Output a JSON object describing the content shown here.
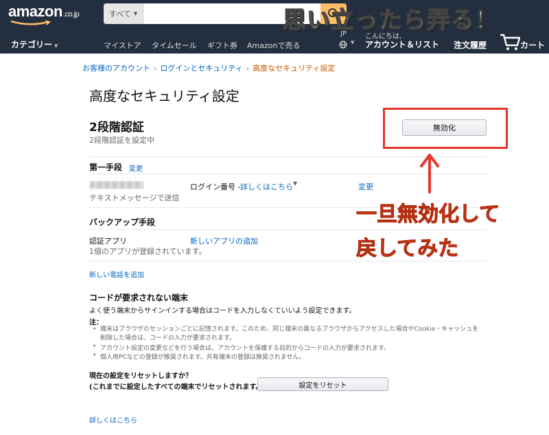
{
  "header": {
    "logo_text": "amazon",
    "logo_suffix": ".co.jp",
    "search_category": "すべて",
    "search_placeholder": "",
    "blog_title": "思い立ったら弄る！",
    "category_menu": "カテゴリー",
    "nav_links": [
      "マイストア",
      "タイムセール",
      "ギフト券",
      "Amazonで売る"
    ],
    "language": "JP",
    "greeting": "こんにちは,",
    "account_list": "アカウント＆リスト",
    "orders": "注文履歴",
    "cart": "カート",
    "colors": {
      "background": "#232f3e",
      "search_button": "#febd69"
    }
  },
  "breadcrumb": {
    "items": [
      "お客様のアカウント",
      "ログインとセキュリティ"
    ],
    "current": "高度なセキュリティ設定"
  },
  "page": {
    "title": "高度なセキュリティ設定",
    "two_step": {
      "heading": "2段階認証",
      "status": "2段階認証を設定中",
      "disable_button": "無効化"
    },
    "primary": {
      "label": "第一手段",
      "change_link": "変更",
      "method": "テキストメッセージで送信",
      "login_number_label": "ログイン番号 - ",
      "details_link": "詳しくはこちら",
      "phone_change_link": "変更"
    },
    "backup": {
      "label": "バックアップ手段",
      "type": "認証アプリ",
      "count_text": "1個のアプリが登録されています。",
      "add_app_link": "新しいアプリの追加",
      "add_phone_link": "新しい電話を追加"
    },
    "devices": {
      "heading": "コードが要求されない端末",
      "description": "よく使う端末からサインインする場合はコードを入力しなくていいよう設定できます。",
      "note_label": "注：",
      "notes": [
        "端末はブラウザのセッションごとに記憶されます。このため、同じ端末の異なるブラウザからアクセスした場合やCookie・キャッシュを",
        "削除した場合は、コードの入力が要求されます。",
        "アカウント設定の変更などを行う場合は、アカウントを保護する目的からコードの入力が要求されます。",
        "個人用PCなどの登録が推奨されます。共有端末の登録は推奨されません。"
      ],
      "reset_question": "現在の設定をリセットしますか？",
      "reset_subtext": "(これまでに設定したすべての端末でリセットされます。)",
      "reset_button": "設定をリセット"
    },
    "learn_more": "詳しくはこちら"
  },
  "annotation": {
    "line1": "一旦無効化して",
    "line2": "戻してみた",
    "color": "#e8352a"
  }
}
